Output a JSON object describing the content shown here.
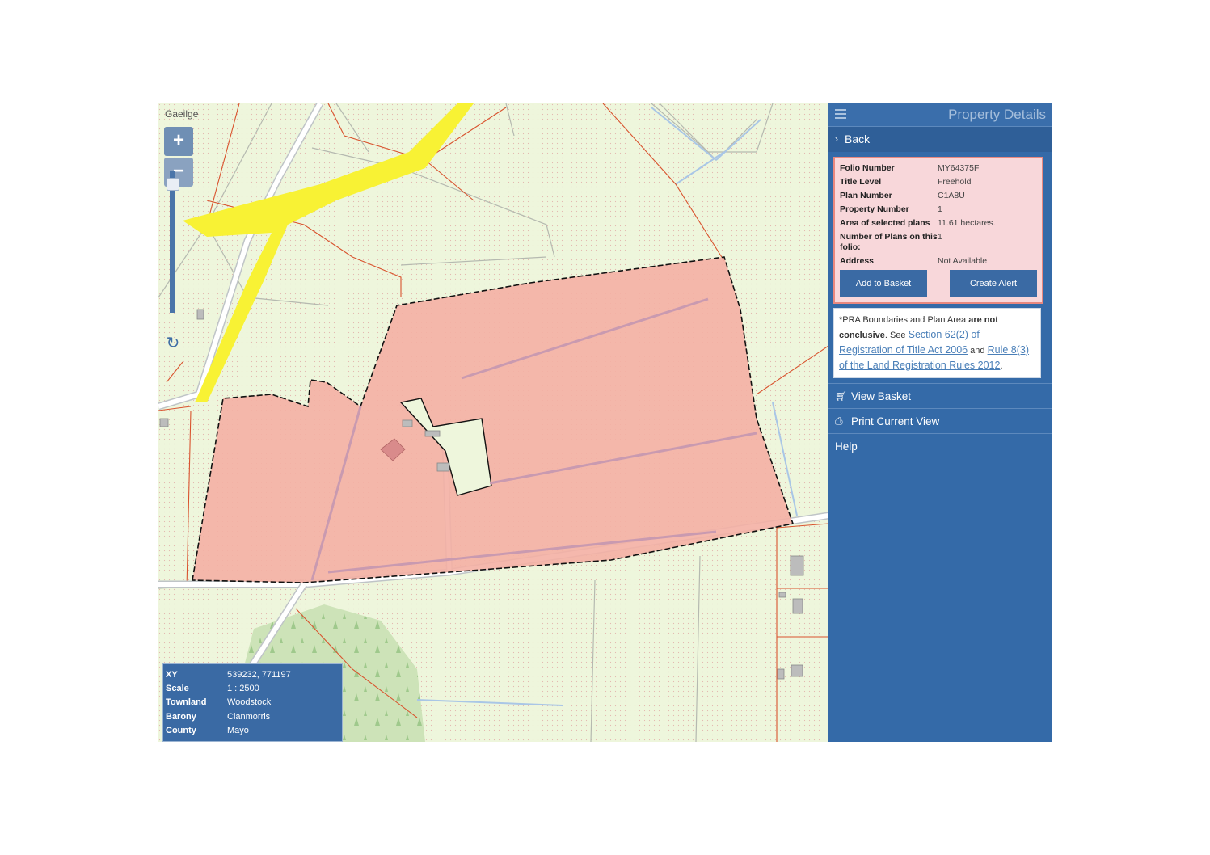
{
  "map": {
    "language_link": "Gaeilge",
    "zoom_in": "+",
    "zoom_out": "−",
    "reset_icon": "refresh-icon",
    "info": [
      {
        "key": "XY",
        "value": "539232, 771197"
      },
      {
        "key": "Scale",
        "value": "1 : 2500"
      },
      {
        "key": "Townland",
        "value": "Woodstock"
      },
      {
        "key": "Barony",
        "value": "Clanmorris"
      },
      {
        "key": "County",
        "value": "Mayo"
      }
    ],
    "colors": {
      "background": "#eef6dc",
      "selected_plan_fill": "#f4b0a4",
      "road_highlight": "#f8f234",
      "boundary_red": "#d9532e",
      "forest": "#c9dfb3"
    }
  },
  "panel": {
    "title": "Property Details",
    "back": "Back",
    "details": [
      {
        "key": "Folio Number",
        "value": "MY64375F"
      },
      {
        "key": "Title Level",
        "value": "Freehold"
      },
      {
        "key": "Plan Number",
        "value": "C1A8U"
      },
      {
        "key": "Property Number",
        "value": "1"
      },
      {
        "key": "Area of selected plans",
        "value": "11.61 hectares."
      },
      {
        "key": "Number of Plans on this folio:",
        "value": "1"
      },
      {
        "key": "Address",
        "value": "Not Available"
      }
    ],
    "add_to_basket": "Add to Basket",
    "create_alert": "Create Alert",
    "note": {
      "prefix": "*PRA Boundaries and Plan Area ",
      "bold": "are not conclusive",
      "mid1": ". See ",
      "link1": "Section 62(2) of Registration of Title Act 2006",
      "mid2": " and ",
      "link2": "Rule 8(3) of the Land Registration Rules 2012",
      "suffix": "."
    },
    "menu": [
      {
        "label": "View Basket",
        "icon": "cart-icon"
      },
      {
        "label": "Print Current View",
        "icon": "printer-icon"
      },
      {
        "label": "Help",
        "icon": ""
      }
    ]
  }
}
